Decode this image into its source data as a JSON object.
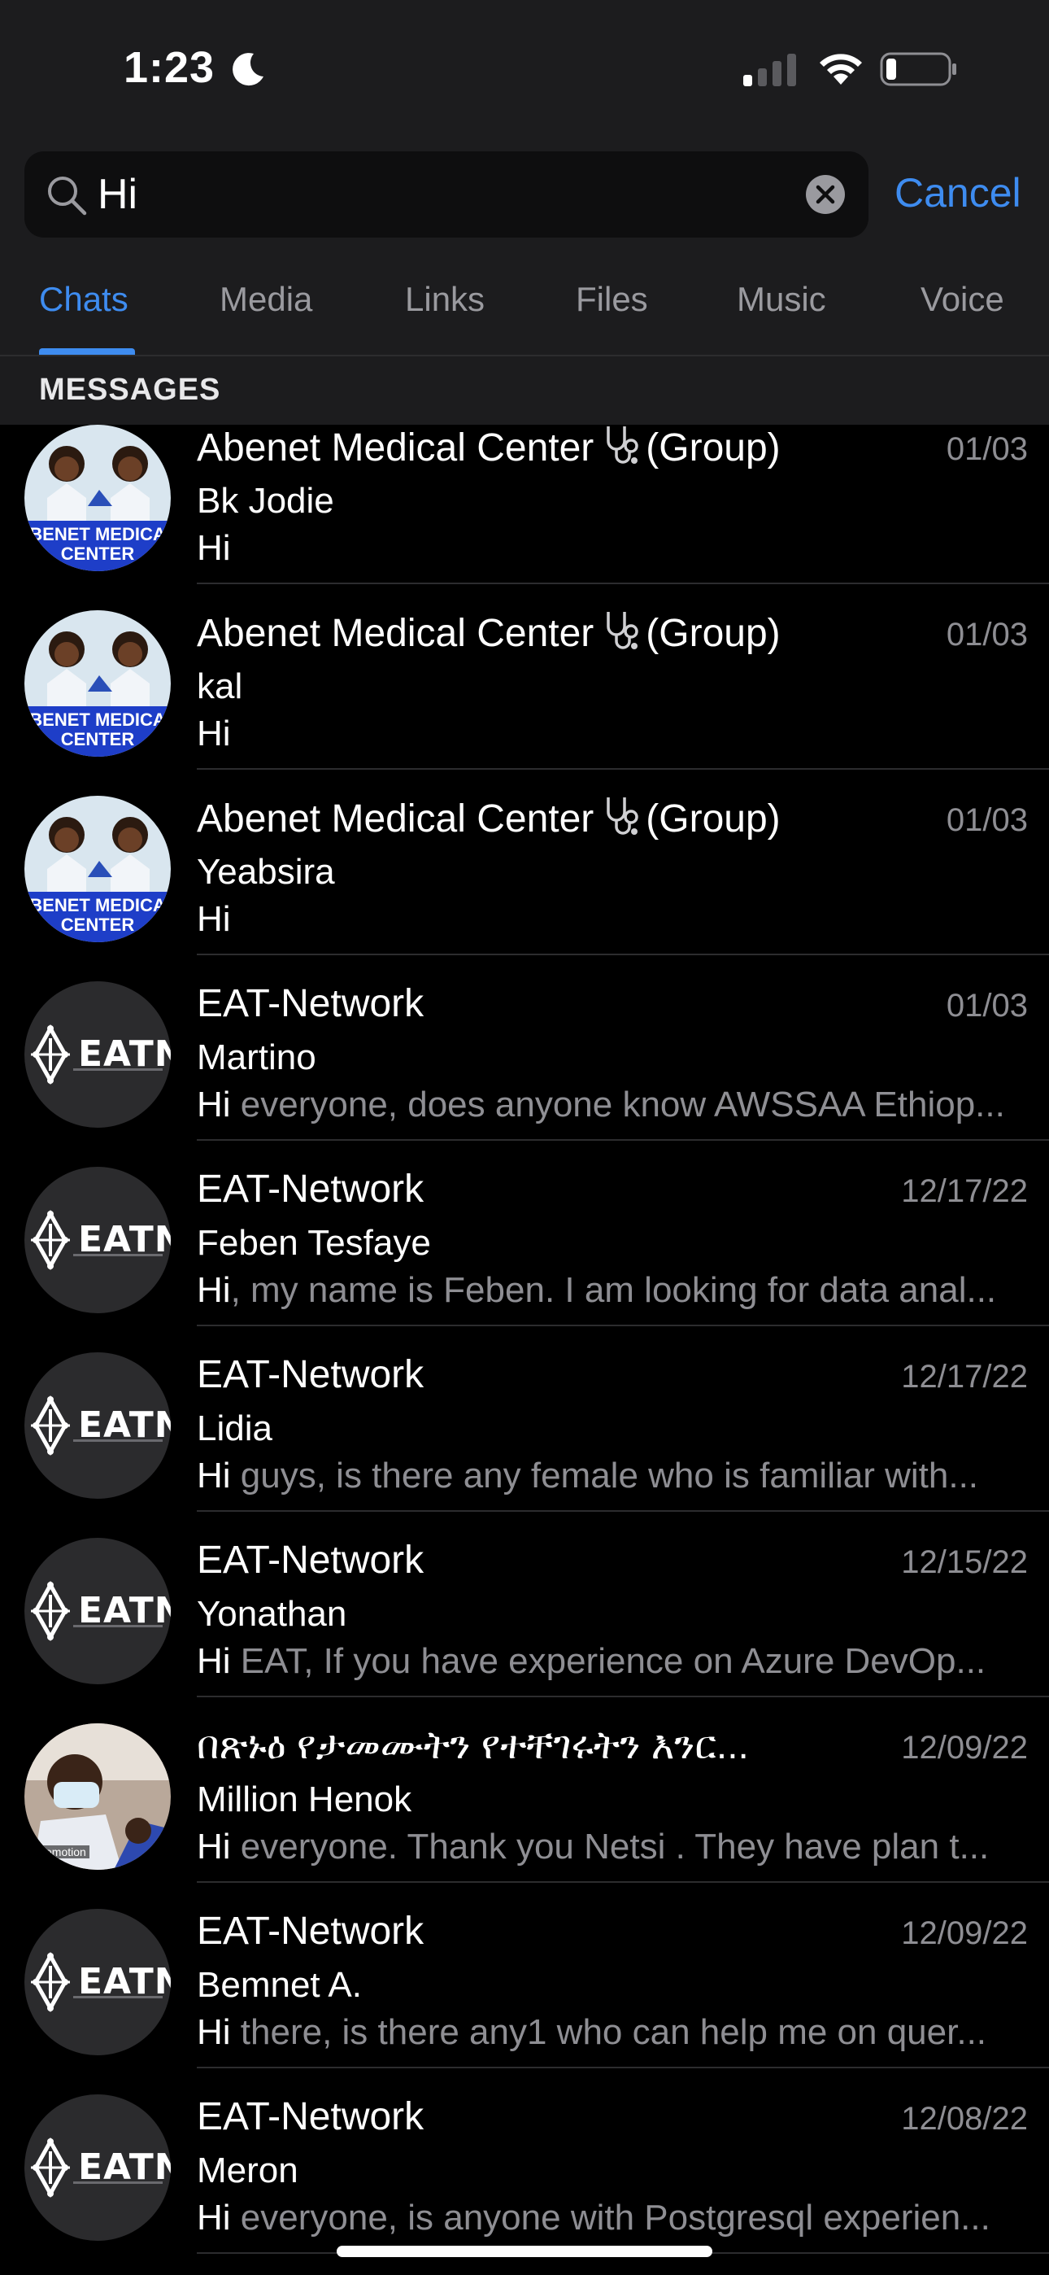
{
  "status_bar": {
    "time": "1:23"
  },
  "search": {
    "value": "Hi",
    "cancel_label": "Cancel"
  },
  "tabs": [
    {
      "label": "Chats",
      "active": true
    },
    {
      "label": "Media"
    },
    {
      "label": "Links"
    },
    {
      "label": "Files"
    },
    {
      "label": "Music"
    },
    {
      "label": "Voice"
    }
  ],
  "section_header": "MESSAGES",
  "messages": [
    {
      "title_main": "Abenet Medical Center",
      "title_suffix": "(Group)",
      "date": "01/03",
      "sender": "Bk Jodie",
      "highlight": "Hi",
      "rest": "",
      "avatar": "abenet",
      "avatar_text": [
        "BENET MEDICA",
        "CENTER"
      ]
    },
    {
      "title_main": "Abenet Medical Center",
      "title_suffix": "(Group)",
      "date": "01/03",
      "sender": "kal",
      "highlight": "Hi",
      "rest": "",
      "avatar": "abenet",
      "avatar_text": [
        "BENET MEDICA",
        "CENTER"
      ]
    },
    {
      "title_main": "Abenet Medical Center",
      "title_suffix": "(Group)",
      "date": "01/03",
      "sender": "Yeabsira",
      "highlight": "Hi",
      "rest": "",
      "avatar": "abenet",
      "avatar_text": [
        "BENET MEDICA",
        "CENTER"
      ]
    },
    {
      "title_main": "EAT-Network",
      "date": "01/03",
      "sender": "Martino",
      "highlight": "Hi",
      "rest": " everyone, does anyone know AWSSAA Ethiop...",
      "avatar": "eatn",
      "avatar_text": [
        "EATN"
      ]
    },
    {
      "title_main": "EAT-Network",
      "date": "12/17/22",
      "sender": "Feben Tesfaye",
      "highlight": "Hi",
      "rest": ", my name is Feben. I am looking for data anal...",
      "avatar": "eatn",
      "avatar_text": [
        "EATN"
      ]
    },
    {
      "title_main": "EAT-Network",
      "date": "12/17/22",
      "sender": "Lidia",
      "highlight": "Hi",
      "rest": " guys, is there any female who is familiar with...",
      "avatar": "eatn",
      "avatar_text": [
        "EATN"
      ]
    },
    {
      "title_main": "EAT-Network",
      "date": "12/15/22",
      "sender": "Yonathan",
      "highlight": "Hi",
      "rest": " EAT,  If you have experience on Azure DevOp...",
      "avatar": "eatn",
      "avatar_text": [
        "EATN"
      ]
    },
    {
      "title_main": "በጽኑዕ የታመሙትን የተቸገሩትን እንር...",
      "date": "12/09/22",
      "sender": "Million Henok",
      "highlight": "Hi",
      "rest": " everyone. Thank you Netsi . They have plan t...",
      "avatar": "photo",
      "avatar_text": [
        "emotion"
      ]
    },
    {
      "title_main": "EAT-Network",
      "date": "12/09/22",
      "sender": "Bemnet A.",
      "highlight": "Hi",
      "rest": " there, is there any1 who can help me on quer...",
      "avatar": "eatn",
      "avatar_text": [
        "EATN"
      ]
    },
    {
      "title_main": "EAT-Network",
      "date": "12/08/22",
      "sender": "Meron",
      "highlight": "Hi",
      "rest": " everyone, is anyone with Postgresql experien...",
      "avatar": "eatn",
      "avatar_text": [
        "EATN"
      ]
    }
  ],
  "colors": {
    "accent": "#3e8cf0",
    "background": "#000000",
    "header": "#1c1c1e",
    "secondary_text": "#8e8e93"
  }
}
